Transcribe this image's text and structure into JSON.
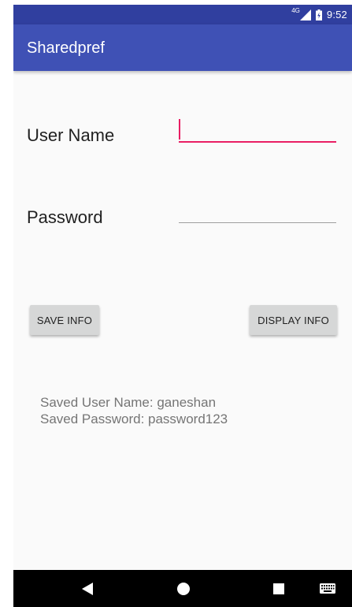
{
  "status_bar": {
    "network": "4G",
    "time": "9:52",
    "icons": [
      "signal-icon",
      "battery-icon"
    ]
  },
  "app_bar": {
    "title": "Sharedpref"
  },
  "form": {
    "username_label": "User Name",
    "username_value": "",
    "password_label": "Password",
    "password_value": ""
  },
  "buttons": {
    "save_label": "SAVE INFO",
    "display_label": "DISPLAY INFO"
  },
  "saved": {
    "username_line": "Saved User Name: ganeshan",
    "password_line": "Saved Password: password123"
  },
  "nav_bar": {
    "icons": [
      "back-icon",
      "home-icon",
      "recents-icon",
      "keyboard-icon"
    ]
  },
  "colors": {
    "status_bar": "#303f9f",
    "app_bar": "#3f51b5",
    "accent": "#e91e63",
    "button": "#d6d7d7"
  }
}
